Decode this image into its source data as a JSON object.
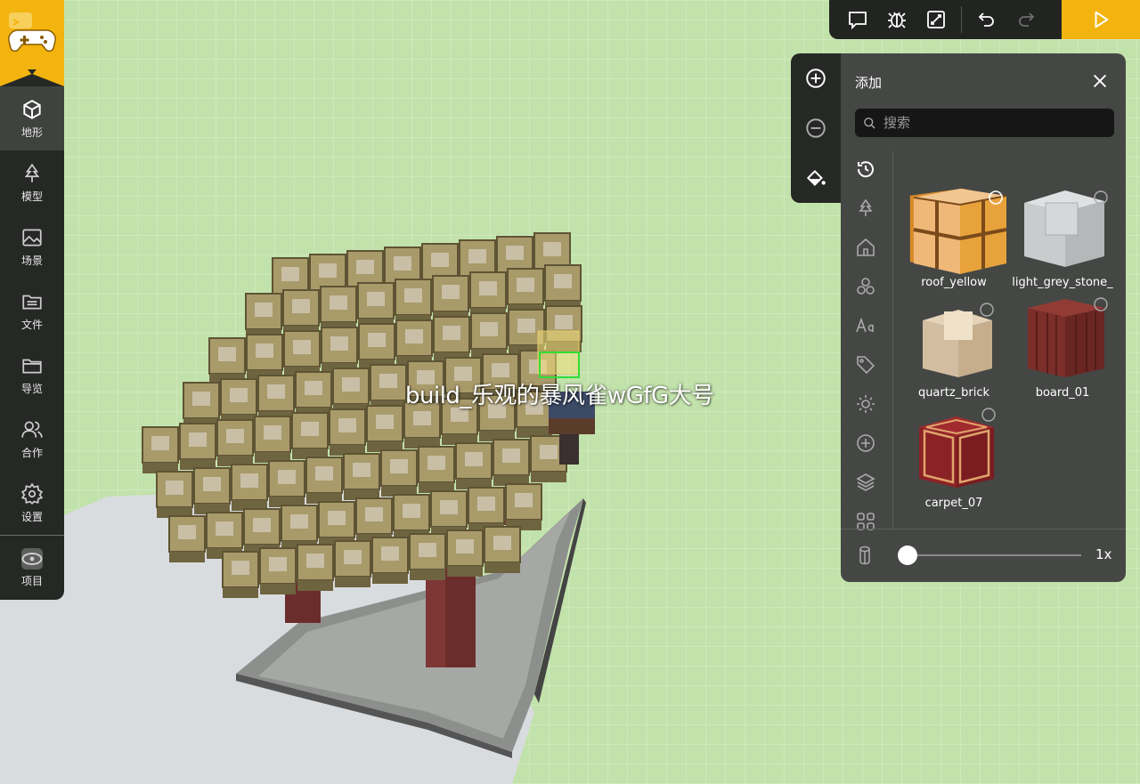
{
  "sidebar": {
    "items": [
      {
        "label": "地形",
        "icon": "cube-icon",
        "active": true
      },
      {
        "label": "模型",
        "icon": "tree-icon",
        "active": false
      },
      {
        "label": "场景",
        "icon": "image-icon",
        "active": false
      },
      {
        "label": "文件",
        "icon": "folder-list-icon",
        "active": false
      },
      {
        "label": "导览",
        "icon": "folder-icon",
        "active": false
      },
      {
        "label": "合作",
        "icon": "users-icon",
        "active": false
      },
      {
        "label": "设置",
        "icon": "gear-icon",
        "active": false
      }
    ],
    "project_label": "项目"
  },
  "toolbar": {
    "buttons": [
      "comment-icon",
      "bug-icon",
      "expand-icon",
      "undo-icon",
      "redo-icon"
    ],
    "play": "play-icon"
  },
  "scene": {
    "player_name": "build_乐观的暴风雀wGfG大号"
  },
  "panel": {
    "title": "添加",
    "search_placeholder": "搜索",
    "categories": [
      "history-icon",
      "tree-icon",
      "house-icon",
      "circles-icon",
      "text-icon",
      "tag-icon",
      "sun-icon",
      "plus-circle-icon",
      "layers-icon",
      "grid-icon"
    ],
    "items": [
      {
        "name": "roof_yellow"
      },
      {
        "name": "light_grey_stone_"
      },
      {
        "name": "quartz_brick"
      },
      {
        "name": "board_01"
      },
      {
        "name": "carpet_07"
      }
    ],
    "brush_size": 0,
    "zoom": "1x"
  },
  "colors": {
    "accent": "#f3b40f",
    "panel": "#454745",
    "sidebar": "#262826",
    "grass": "#c2e2ab"
  }
}
